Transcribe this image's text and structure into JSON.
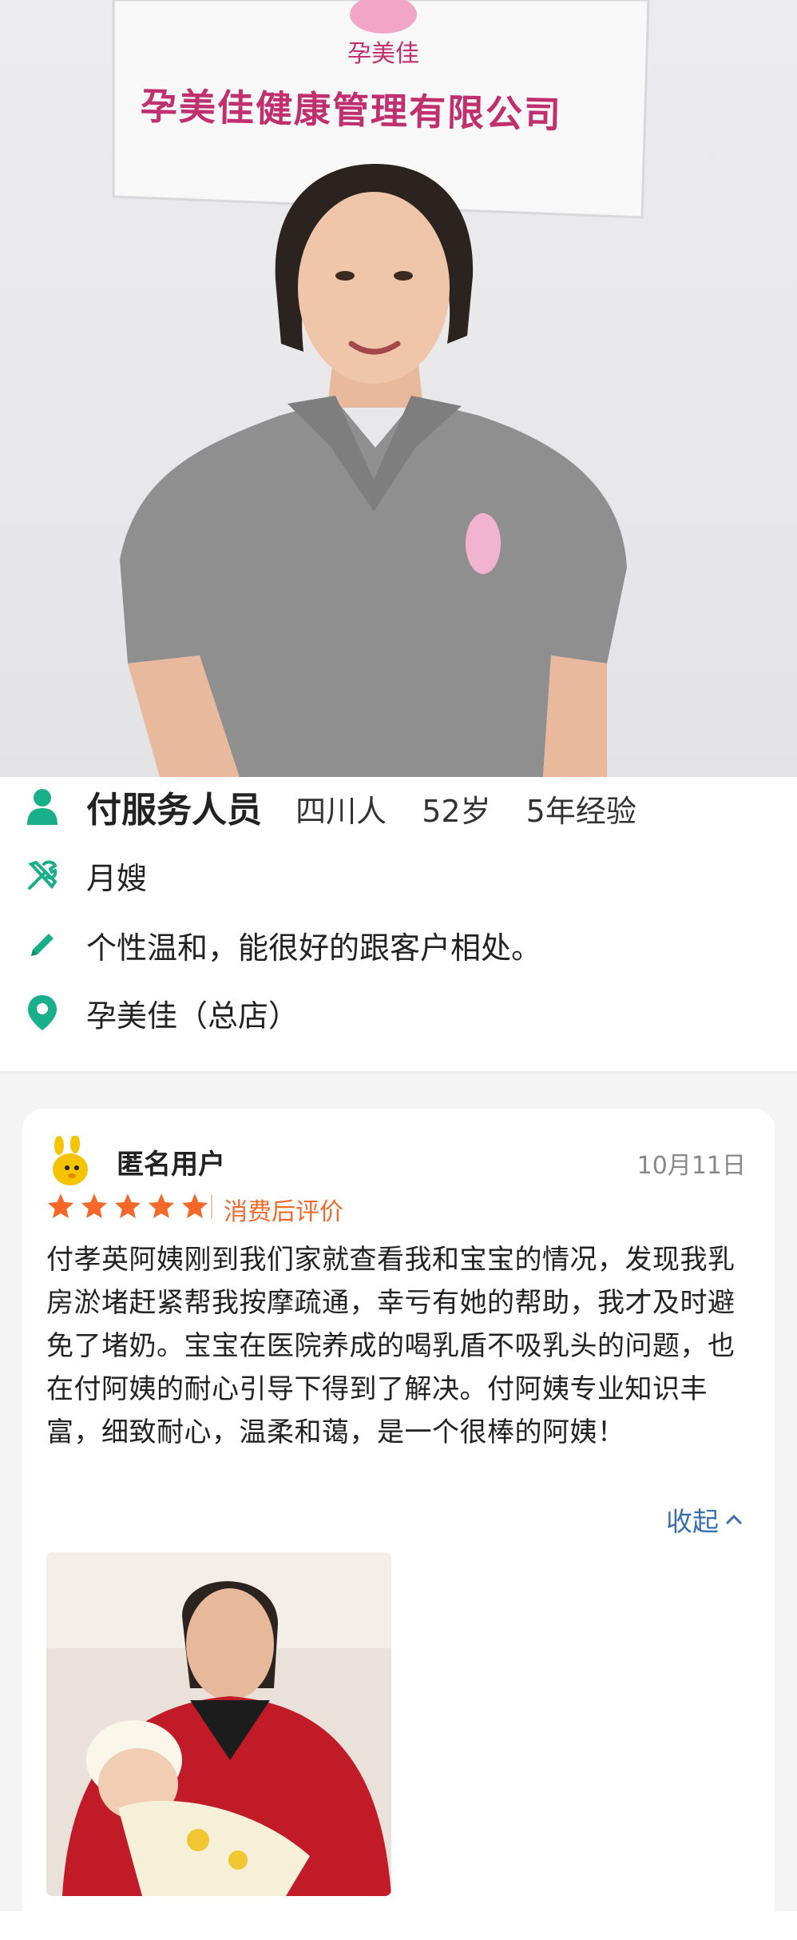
{
  "hero": {
    "sign_brand": "孕美佳",
    "sign_company": "孕美佳健康管理有限公司"
  },
  "profile": {
    "name": "付服务人员",
    "origin": "四川人",
    "age": "52岁",
    "experience": "5年经验",
    "role": "月嫂",
    "description": "个性温和，能很好的跟客户相处。",
    "store": "孕美佳（总店）",
    "icons": [
      "person-icon",
      "tools-icon",
      "pencil-icon",
      "location-pin-icon"
    ],
    "icon_color": "#1aaf8b"
  },
  "review": {
    "user": "匿名用户",
    "date": "10月11日",
    "rating": 5,
    "tag": "消费后评价",
    "text": "付孝英阿姨刚到我们家就查看我和宝宝的情况，发现我乳房淤堵赶紧帮我按摩疏通，幸亏有她的帮助，我才及时避免了堵奶。宝宝在医院养成的喝乳盾不吸乳头的问题，也在付阿姨的耐心引导下得到了解决。付阿姨专业知识丰富，细致耐心，温柔和蔼，是一个很棒的阿姨！",
    "collapse_label": "收起",
    "star_color": "#f6672a",
    "link_color": "#3a6faf"
  }
}
